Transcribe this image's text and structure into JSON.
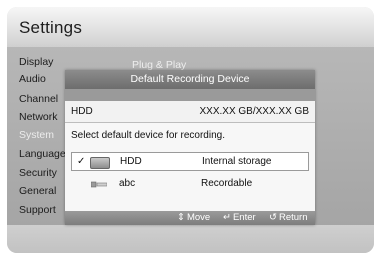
{
  "header": {
    "title": "Settings"
  },
  "menu": {
    "items": [
      {
        "label": "Display"
      },
      {
        "label": "Audio"
      },
      {
        "label": "Channel"
      },
      {
        "label": "Network"
      },
      {
        "label": "System"
      },
      {
        "label": "Language"
      },
      {
        "label": "Security"
      },
      {
        "label": "General"
      },
      {
        "label": "Support"
      }
    ],
    "submenu_label": "Plug & Play"
  },
  "dialog": {
    "title": "Default Recording Device",
    "current_device": {
      "name": "HDD",
      "capacity": "XXX.XX GB/XXX.XX GB"
    },
    "instruction": "Select default device for recording.",
    "devices": [
      {
        "check": "✓",
        "name": "HDD",
        "type": "Internal storage",
        "icon": "hdd-icon",
        "selected": true
      },
      {
        "check": "",
        "name": "abc",
        "type": "Recordable",
        "icon": "usb-icon",
        "selected": false
      }
    ],
    "footer": [
      {
        "icon": "⇕",
        "label": "Move"
      },
      {
        "icon": "↵",
        "label": "Enter"
      },
      {
        "icon": "↺",
        "label": "Return"
      }
    ]
  },
  "colors": {
    "title_bar": "#7a7a7a",
    "panel": "#aeaeae",
    "selected_row": "#ffffff"
  }
}
